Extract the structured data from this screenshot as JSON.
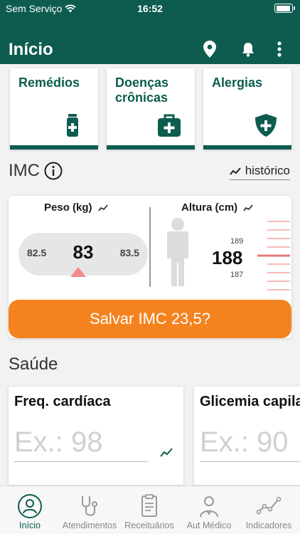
{
  "status_bar": {
    "carrier": "Sem Serviço",
    "time": "16:52"
  },
  "app_bar": {
    "title": "Início"
  },
  "categories": [
    {
      "label": "Remédios",
      "icon": "medicine-bottle-icon"
    },
    {
      "label": "Doenças crônicas",
      "icon": "medical-kit-icon"
    },
    {
      "label": "Alergias",
      "icon": "shield-plus-icon"
    }
  ],
  "imc": {
    "title": "IMC",
    "history_label": "histórico",
    "weight": {
      "title": "Peso (kg)",
      "previous": "82.5",
      "current": "83",
      "next": "83.5"
    },
    "height": {
      "title": "Altura (cm)",
      "above": "189",
      "current": "188",
      "below": "187"
    },
    "save_label": "Salvar IMC 23,5?"
  },
  "health": {
    "title": "Saúde",
    "metrics": [
      {
        "label": "Freq. cardíaca",
        "placeholder": "Ex.: 98"
      },
      {
        "label": "Glicemia capilar",
        "placeholder": "Ex.: 90"
      }
    ]
  },
  "bottom_nav": [
    {
      "label": "Início",
      "icon": "user-icon",
      "active": true
    },
    {
      "label": "Atendimentos",
      "icon": "stethoscope-icon"
    },
    {
      "label": "Receituários",
      "icon": "prescription-icon"
    },
    {
      "label": "Aut Médico",
      "icon": "doctor-icon"
    },
    {
      "label": "Indicadores",
      "icon": "chart-line-icon"
    }
  ],
  "colors": {
    "primary": "#0d5c4f",
    "accent": "#f4831f",
    "marker": "#f28b8b",
    "ruler": "#e87a7a"
  }
}
